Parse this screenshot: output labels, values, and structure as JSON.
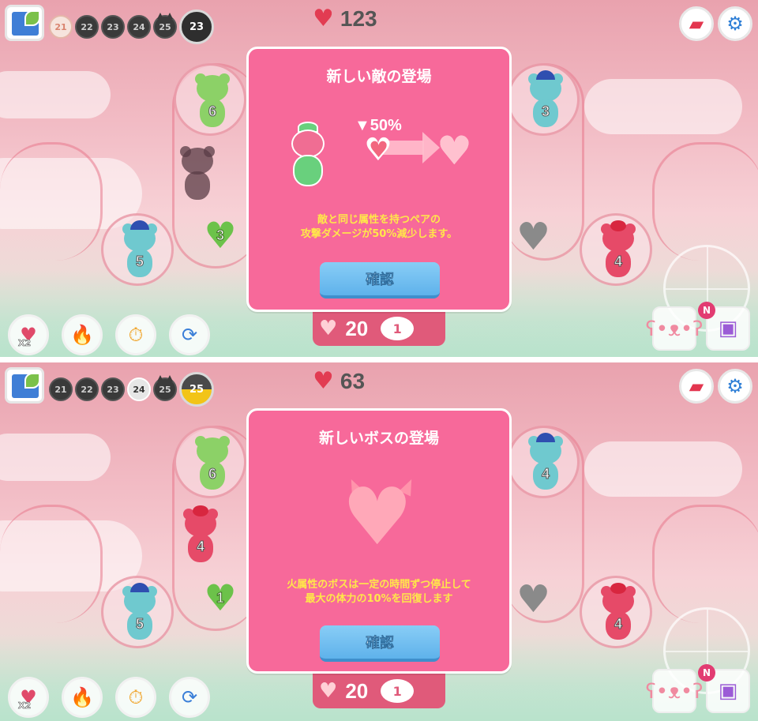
{
  "top": {
    "stages": [
      "21",
      "22",
      "23",
      "24",
      "25",
      "23"
    ],
    "hp": "123",
    "board": {
      "bear_green_level": "6",
      "bear_blue_left_level": "5",
      "bear_blue_right_level": "3",
      "bear_red_right_level": "4",
      "leaf_heart_count": "3"
    },
    "skills": {
      "x2_label": "X2"
    },
    "bottom_center": {
      "hearts": "20",
      "badge": "1"
    },
    "dialog": {
      "title": "新しい敵の登場",
      "percent": "▼50%",
      "desc_line1": "敵と同じ属性を持つペアの",
      "desc_line2": "攻撃ダメージが50%減少します。",
      "confirm": "確認"
    }
  },
  "bottom": {
    "stages": [
      "21",
      "22",
      "23",
      "24",
      "25",
      "25"
    ],
    "hp": "63",
    "board": {
      "bear_green_level": "6",
      "bear_red_left_level": "4",
      "bear_blue_left_level": "5",
      "bear_blue_right_level": "4",
      "bear_red_right_level": "4",
      "leaf_heart_count": "1"
    },
    "skills": {
      "x2_label": "X2"
    },
    "bottom_center": {
      "hearts": "20",
      "badge": "1"
    },
    "dialog": {
      "title": "新しいボスの登場",
      "desc_line1": "火属性のボスは一定の時間ずつ停止して",
      "desc_line2": "最大の体力の10%を回復します",
      "confirm": "確認"
    }
  },
  "badges": {
    "new": "N"
  },
  "colors": {
    "dialog_bg": "#f7699a",
    "confirm_btn": "#6ebcf0",
    "desc_text": "#ffe74a",
    "hp_heart": "#e23c52"
  }
}
